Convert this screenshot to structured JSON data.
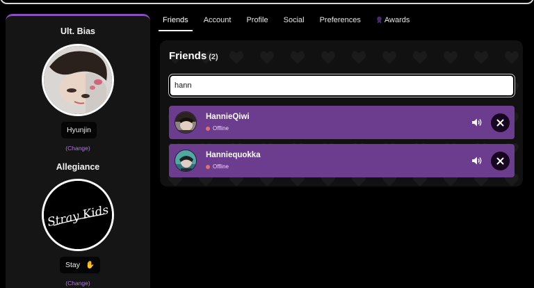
{
  "sidebar": {
    "bias_heading": "Ult. Bias",
    "bias_name": "Hyunjin",
    "bias_change": "(Change)",
    "allegiance_heading": "Allegiance",
    "allegiance_name": "Stay",
    "allegiance_emoji": "✋",
    "allegiance_change": "(Change)",
    "logo_text": "Stray Kids"
  },
  "tabs": [
    {
      "label": "Friends",
      "active": true
    },
    {
      "label": "Account"
    },
    {
      "label": "Profile"
    },
    {
      "label": "Social"
    },
    {
      "label": "Preferences"
    },
    {
      "label": "Awards",
      "icon": "award-icon"
    }
  ],
  "friends_panel": {
    "title": "Friends",
    "count": "(2)",
    "search_value": "hann",
    "rows": [
      {
        "name": "HannieQiwi",
        "status": "Offline"
      },
      {
        "name": "Hanniequokka",
        "status": "Offline"
      }
    ]
  },
  "colors": {
    "accent": "#8a4fbf",
    "row_bg": "#6c3c8e",
    "offline": "#e0736f"
  }
}
